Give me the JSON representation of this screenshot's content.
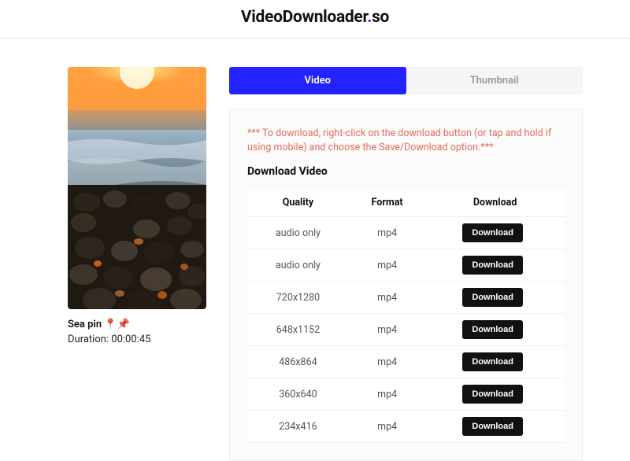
{
  "brand": {
    "main": "VideoDownloader",
    "suffix": "so"
  },
  "video": {
    "title": "Sea pin 📍📌",
    "duration_label": "Duration: 00:00:45"
  },
  "tabs": {
    "video": "Video",
    "thumbnail": "Thumbnail",
    "active": "video"
  },
  "notice": "*** To download, right-click on the download button (or tap and hold if using mobile) and choose the Save/Download option.***",
  "section_title": "Download Video",
  "table": {
    "headers": {
      "quality": "Quality",
      "format": "Format",
      "download": "Download"
    },
    "download_label": "Download",
    "rows": [
      {
        "quality": "audio only",
        "format": "mp4"
      },
      {
        "quality": "audio only",
        "format": "mp4"
      },
      {
        "quality": "720x1280",
        "format": "mp4"
      },
      {
        "quality": "648x1152",
        "format": "mp4"
      },
      {
        "quality": "486x864",
        "format": "mp4"
      },
      {
        "quality": "360x640",
        "format": "mp4"
      },
      {
        "quality": "234x416",
        "format": "mp4"
      }
    ]
  }
}
